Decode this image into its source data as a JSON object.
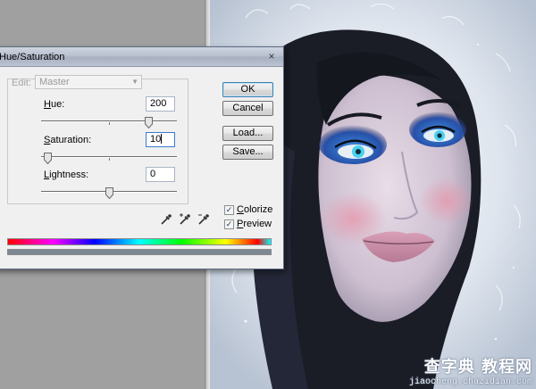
{
  "dialog": {
    "title": "Hue/Saturation",
    "close_glyph": "×",
    "edit_label": "Edit:",
    "edit_value": "Master",
    "hue": {
      "label": "Hue:",
      "value": "200",
      "slider_fraction": 0.79
    },
    "saturation": {
      "label": "Saturation:",
      "value": "10",
      "slider_fraction": 0.05
    },
    "lightness": {
      "label": "Lightness:",
      "value": "0",
      "slider_fraction": 0.5
    },
    "buttons": {
      "ok": "OK",
      "cancel": "Cancel",
      "load": "Load...",
      "save": "Save..."
    },
    "colorize": {
      "label": "Colorize",
      "checked": true
    },
    "preview": {
      "label": "Preview",
      "checked": true
    },
    "check_glyph": "✓",
    "colorize_hue_color": "#7d8893"
  },
  "watermark": {
    "main": "查字典 教程网",
    "sub": "jiaocheng.chazidian.com"
  },
  "icons": [
    "close-icon",
    "dropdown-arrow-icon",
    "eyedropper-icon",
    "eyedropper-plus-icon",
    "eyedropper-minus-icon",
    "checkmark-icon"
  ]
}
